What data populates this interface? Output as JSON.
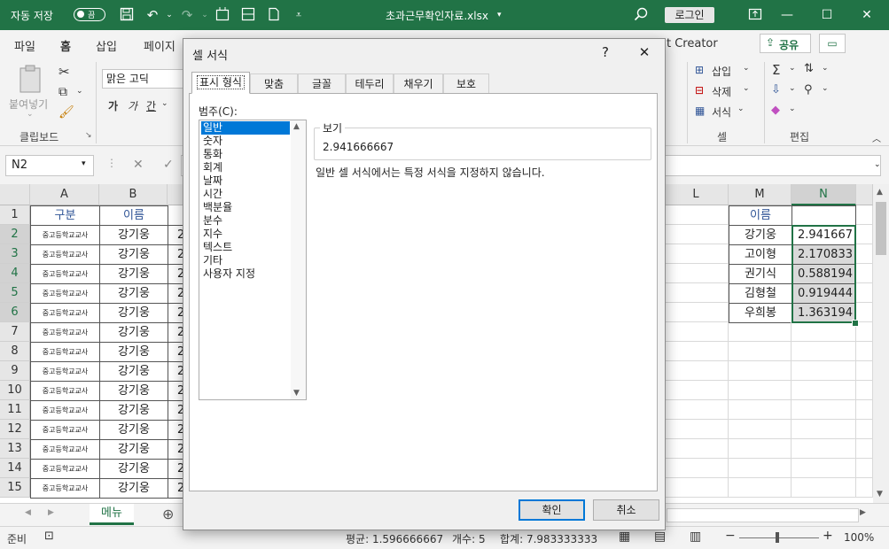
{
  "titlebar": {
    "autosave_label": "자동 저장",
    "autosave_state": "끔",
    "filename": "초과근무확인자료.xlsx",
    "login": "로그인"
  },
  "ribbon": {
    "tabs": [
      "파일",
      "홈",
      "삽입",
      "페이지"
    ],
    "tab_right": "t Creator",
    "share": "공유",
    "paste": "붙여넣기",
    "clipboard_group": "클립보드",
    "font_name": "맑은 고딕",
    "font_bold": "가",
    "font_italic": "가",
    "font_underline": "간",
    "insert": "삽입",
    "delete": "삭제",
    "format": "서식",
    "cells_group": "셀",
    "editing_group": "편집"
  },
  "formula_bar": {
    "name_box": "N2"
  },
  "grid": {
    "columns": [
      "A",
      "B",
      "L",
      "M",
      "N"
    ],
    "rows": [
      "1",
      "2",
      "3",
      "4",
      "5",
      "6",
      "7",
      "8",
      "9",
      "10",
      "11",
      "12",
      "13",
      "14",
      "15"
    ],
    "header_A": "구분",
    "header_B": "이름",
    "col_c_partial": "2",
    "colA_value": "중고등학교교사",
    "colB_value": "강기웅",
    "M_header": "이름",
    "M_values": [
      "강기웅",
      "고이형",
      "권기식",
      "김형철",
      "우희봉"
    ],
    "N_values": [
      "2.941667",
      "2.170833",
      "0.588194",
      "0.919444",
      "1.363194"
    ]
  },
  "sheet_tab": "메뉴",
  "status": {
    "ready": "준비",
    "average": "평균: 1.596666667",
    "count": "개수: 5",
    "sum": "합계: 7.983333333",
    "zoom": "100%"
  },
  "dialog": {
    "title": "셀 서식",
    "help": "?",
    "tabs": [
      "표시 형식",
      "맞춤",
      "글꼴",
      "테두리",
      "채우기",
      "보호"
    ],
    "category_label": "범주(C):",
    "categories": [
      "일반",
      "숫자",
      "통화",
      "회계",
      "날짜",
      "시간",
      "백분율",
      "분수",
      "지수",
      "텍스트",
      "기타",
      "사용자 지정"
    ],
    "sample_label": "보기",
    "sample_value": "2.941666667",
    "description": "일반 셀 서식에서는 특정 서식을 지정하지 않습니다.",
    "ok": "확인",
    "cancel": "취소"
  }
}
